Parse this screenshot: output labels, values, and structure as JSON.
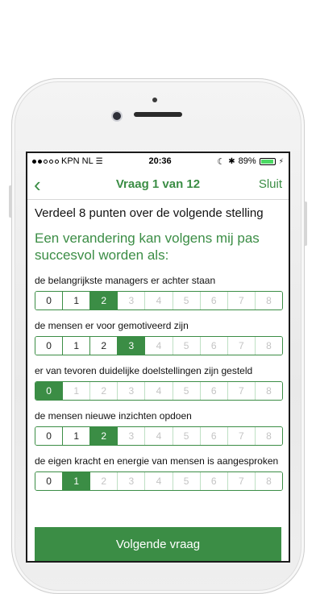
{
  "status_bar": {
    "carrier": "KPN NL",
    "time": "20:36",
    "battery": "89%",
    "signal_full": 2,
    "signal_total": 5
  },
  "nav": {
    "title": "Vraag 1 van 12",
    "close": "Sluit"
  },
  "instruction": "Verdeel 8 punten over de volgende stelling",
  "statement": "Een verandering kan volgens mij pas succesvol worden als:",
  "questions": [
    {
      "label": "de belangrijkste managers er achter staan",
      "selected": 2,
      "max_enabled": 2
    },
    {
      "label": "de mensen er voor gemotiveerd zijn",
      "selected": 3,
      "max_enabled": 3
    },
    {
      "label": "er van tevoren duidelijke doelstellingen zijn gesteld",
      "selected": 0,
      "max_enabled": 0
    },
    {
      "label": "de mensen nieuwe inzichten opdoen",
      "selected": 2,
      "max_enabled": 2
    },
    {
      "label": "de eigen kracht en energie van mensen is aangesproken",
      "selected": 1,
      "max_enabled": 1
    }
  ],
  "scale_values": [
    "0",
    "1",
    "2",
    "3",
    "4",
    "5",
    "6",
    "7",
    "8"
  ],
  "next_button": "Volgende vraag",
  "colors": {
    "accent": "#3b8d45"
  }
}
